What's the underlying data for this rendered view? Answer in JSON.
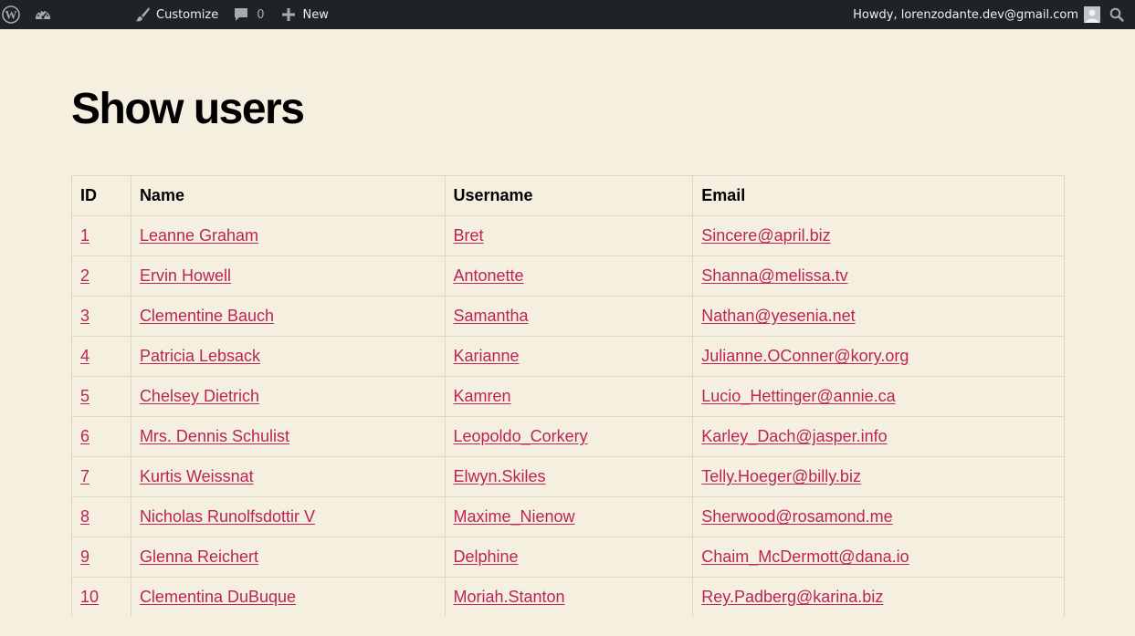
{
  "adminbar": {
    "customize_label": "Customize",
    "comments_count": "0",
    "new_label": "New",
    "greeting": "Howdy, lorenzodante.dev@gmail.com"
  },
  "page": {
    "title": "Show users"
  },
  "table": {
    "headers": [
      "ID",
      "Name",
      "Username",
      "Email"
    ],
    "rows": [
      {
        "id": "1",
        "name": "Leanne Graham",
        "username": "Bret",
        "email": "Sincere@april.biz"
      },
      {
        "id": "2",
        "name": "Ervin Howell",
        "username": "Antonette",
        "email": "Shanna@melissa.tv"
      },
      {
        "id": "3",
        "name": "Clementine Bauch",
        "username": "Samantha",
        "email": "Nathan@yesenia.net"
      },
      {
        "id": "4",
        "name": "Patricia Lebsack",
        "username": "Karianne",
        "email": "Julianne.OConner@kory.org"
      },
      {
        "id": "5",
        "name": "Chelsey Dietrich",
        "username": "Kamren",
        "email": "Lucio_Hettinger@annie.ca"
      },
      {
        "id": "6",
        "name": "Mrs. Dennis Schulist",
        "username": "Leopoldo_Corkery",
        "email": "Karley_Dach@jasper.info"
      },
      {
        "id": "7",
        "name": "Kurtis Weissnat",
        "username": "Elwyn.Skiles",
        "email": "Telly.Hoeger@billy.biz"
      },
      {
        "id": "8",
        "name": "Nicholas Runolfsdottir V",
        "username": "Maxime_Nienow",
        "email": "Sherwood@rosamond.me"
      },
      {
        "id": "9",
        "name": "Glenna Reichert",
        "username": "Delphine",
        "email": "Chaim_McDermott@dana.io"
      },
      {
        "id": "10",
        "name": "Clementina DuBuque",
        "username": "Moriah.Stanton",
        "email": "Rey.Padberg@karina.biz"
      }
    ]
  },
  "colors": {
    "background": "#f5efe0",
    "adminbar": "#1d2327",
    "link": "#bb2455",
    "border": "#dcd6c6"
  }
}
